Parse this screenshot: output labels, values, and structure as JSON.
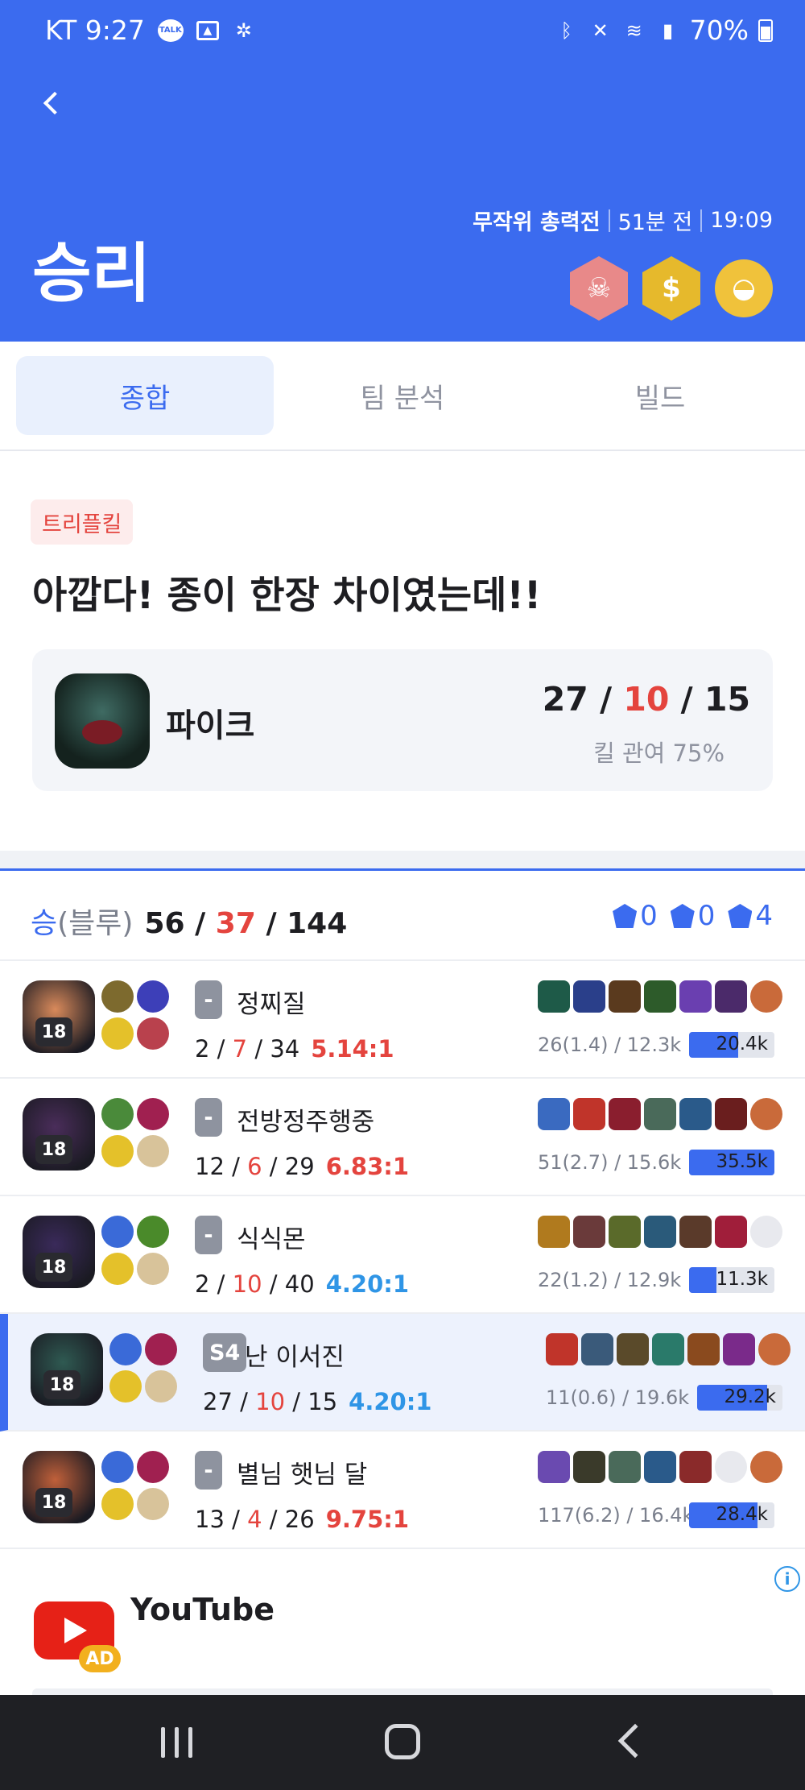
{
  "status_bar": {
    "carrier_time": "KT 9:27",
    "talk_icon": "TALK",
    "battery": "70%"
  },
  "header": {
    "mode": "무작위 총력전",
    "ago": "51분 전",
    "duration": "19:09",
    "result": "승리",
    "color_bg": "#3b6bef"
  },
  "tabs": [
    {
      "label": "종합",
      "active": true
    },
    {
      "label": "팀 분석",
      "active": false
    },
    {
      "label": "빌드",
      "active": false
    }
  ],
  "summary": {
    "tag": "트리플킬",
    "headline": "아깝다! 종이 한장 차이였는데!!",
    "champion": "파이크",
    "kills": "27",
    "deaths": "10",
    "assists": "15",
    "kill_participation": "킬 관여 75%"
  },
  "team": {
    "result": "승",
    "side": "(블루)",
    "kills": "56",
    "deaths": "37",
    "assists": "144",
    "objectives": [
      {
        "icon": "baron-icon",
        "value": "0"
      },
      {
        "icon": "dragon-icon",
        "value": "0"
      },
      {
        "icon": "tower-icon",
        "value": "4"
      }
    ]
  },
  "players": [
    {
      "level": "18",
      "rank": "-",
      "name": "정찌질",
      "k": "2",
      "d": "7",
      "a": "34",
      "ratio": "5.14:1",
      "ratio_color": "red",
      "cs": "26(1.4) / 12.3k",
      "damage": "20.4k",
      "damage_fraction": 0.58,
      "me": false,
      "avatar_color": "#d98a5b",
      "spells": [
        "#7d6a2e",
        "#3d3fb8",
        "#e4c12a",
        "#b9414d"
      ],
      "items": [
        "#1e5a48",
        "#2a3f8a",
        "#5a3a1e",
        "#2d5b2a",
        "#6a3fb0",
        "#4b2a6a",
        "#c96a3a"
      ]
    },
    {
      "level": "18",
      "rank": "-",
      "name": "전방정주행중",
      "k": "12",
      "d": "6",
      "a": "29",
      "ratio": "6.83:1",
      "ratio_color": "red",
      "cs": "51(2.7) / 15.6k",
      "damage": "35.5k",
      "damage_fraction": 1.0,
      "me": false,
      "avatar_color": "#4a2d5a",
      "spells": [
        "#4a8a3a",
        "#a02050",
        "#e4c12a",
        "#d8c39a"
      ],
      "items": [
        "#3a6ac0",
        "#c0342a",
        "#8a1e2e",
        "#4a6a5a",
        "#2a5a8a",
        "#6a1e1e",
        "#c96a3a"
      ]
    },
    {
      "level": "18",
      "rank": "-",
      "name": "식식몬",
      "k": "2",
      "d": "10",
      "a": "40",
      "ratio": "4.20:1",
      "ratio_color": "blue",
      "cs": "22(1.2) / 12.9k",
      "damage": "11.3k",
      "damage_fraction": 0.32,
      "me": false,
      "avatar_color": "#3a2a5a",
      "spells": [
        "#3a6ad8",
        "#4a8a2a",
        "#e4c12a",
        "#d8c39a"
      ],
      "items": [
        "#b07a1e",
        "#6a3a3a",
        "#5a6a2a",
        "#2a5a7a",
        "#5a3a2a",
        "#a01e3a",
        "empty"
      ]
    },
    {
      "level": "18",
      "rank": "S4",
      "name": "난 이서진",
      "k": "27",
      "d": "10",
      "a": "15",
      "ratio": "4.20:1",
      "ratio_color": "blue",
      "cs": "11(0.6) / 19.6k",
      "damage": "29.2k",
      "damage_fraction": 0.82,
      "me": true,
      "avatar_color": "#2f5a52",
      "spells": [
        "#3a6ad8",
        "#a02050",
        "#e4c12a",
        "#d8c39a"
      ],
      "items": [
        "#c0342a",
        "#3a5a7a",
        "#5a4a2a",
        "#2a7a6a",
        "#8a4a1e",
        "#7a2a8a",
        "#c96a3a"
      ]
    },
    {
      "level": "18",
      "rank": "-",
      "name": "별님 햇님 달",
      "k": "13",
      "d": "4",
      "a": "26",
      "ratio": "9.75:1",
      "ratio_color": "red",
      "cs": "117(6.2) / 16.4k",
      "damage": "28.4k",
      "damage_fraction": 0.8,
      "me": false,
      "avatar_color": "#c0603a",
      "spells": [
        "#3a6ad8",
        "#a02050",
        "#e4c12a",
        "#d8c39a"
      ],
      "items": [
        "#6a4ab0",
        "#3a3a2a",
        "#4a6a5a",
        "#2a5a8a",
        "#8a2a2a",
        "empty",
        "#c96a3a"
      ]
    }
  ],
  "ad": {
    "title": "YouTube",
    "badge": "AD",
    "info": "i"
  }
}
